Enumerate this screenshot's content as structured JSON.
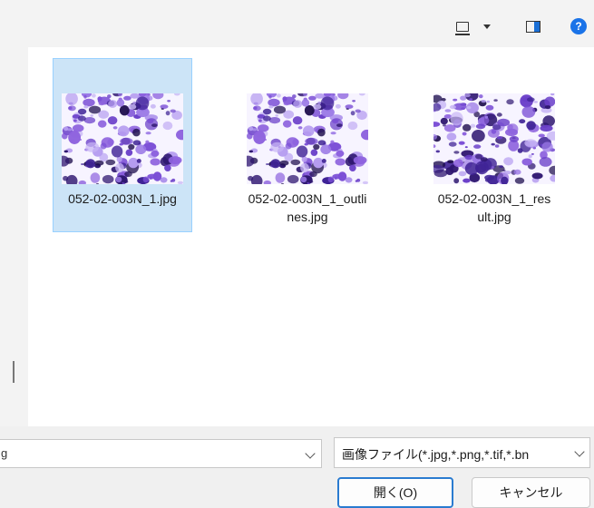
{
  "toolbar": {
    "view_icon": "view-layout-icon",
    "dropdown_icon": "chevron-down-icon",
    "pane_icon": "preview-pane-icon",
    "help_icon": "help-icon",
    "help_glyph": "?",
    "accent": "#1a73e8"
  },
  "files": [
    {
      "name": "052-02-003N_1.jpg",
      "selected": true
    },
    {
      "name": "052-02-003N_1_outlines.jpg",
      "selected": false
    },
    {
      "name": "052-02-003N_1_result.jpg",
      "selected": false
    }
  ],
  "bottom": {
    "filename_value": "g",
    "filter_value": "画像ファイル(*.jpg,*.png,*.tif,*.bn",
    "open_label": "開く(O)",
    "cancel_label": "キャンセル"
  },
  "colors": {
    "selection_bg": "#cce4f7",
    "selection_border": "#99d1ff",
    "thumb_purple": "#7b4fd6"
  }
}
